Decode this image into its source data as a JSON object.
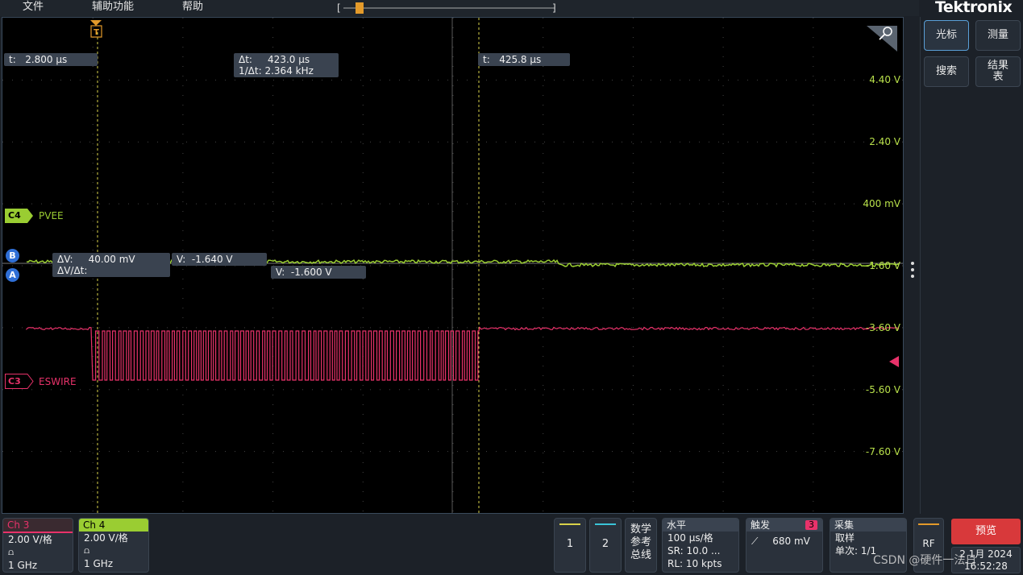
{
  "menu": {
    "file": "文件",
    "assist": "辅助功能",
    "help": "帮助"
  },
  "brand": "Tektronix",
  "colors": {
    "ch4": "#9acd32",
    "ch3": "#e8326a",
    "cursor": "#d9d24a",
    "cursor_white": "#b8b8b8",
    "accent_blue": "#2f6fd6",
    "preview": "#d8393b"
  },
  "cursors": {
    "t1": {
      "label": "t:",
      "value": "2.800 μs"
    },
    "t2": {
      "label": "t:",
      "value": "425.8 μs"
    },
    "delta_t": {
      "label": "Δt:",
      "value": "423.0 μs"
    },
    "inv_delta_t": {
      "label": "1/Δt:",
      "value": "2.364 kHz"
    },
    "delta_v": {
      "label": "ΔV:",
      "value": "40.00 mV"
    },
    "dv_dt": {
      "label": "ΔV/Δt:",
      "value": ""
    },
    "v_a": {
      "label": "V:",
      "value": "-1.640 V"
    },
    "v_b": {
      "label": "V:",
      "value": "-1.600 V"
    },
    "marker_a": "A",
    "marker_b": "B",
    "trigger_marker": "T"
  },
  "channels": {
    "c4": {
      "tag": "C4",
      "name": "PVEE"
    },
    "c3": {
      "tag": "C3",
      "name": "ESWIRE"
    }
  },
  "voltage_scale": [
    "4.40 V",
    "2.40 V",
    "400 mV",
    "-1.60 V",
    "-3.60 V",
    "-5.60 V",
    "-7.60 V"
  ],
  "right_panel": {
    "cursor": "光标",
    "measure": "测量",
    "search": "搜索",
    "results_1": "结果",
    "results_2": "表"
  },
  "bottom": {
    "ch3": {
      "title": "Ch 3",
      "scale": "2.00 V/格",
      "bw": "1 GHz"
    },
    "ch4": {
      "title": "Ch 4",
      "scale": "2.00 V/格",
      "bw": "1 GHz"
    },
    "ref1": "1",
    "ref2": "2",
    "digital": [
      "数学",
      "参考",
      "总线"
    ],
    "horizontal": {
      "title": "水平",
      "scale": "100 μs/格",
      "sr": "SR: 10.0 ...",
      "rl": "RL: 10 kpts"
    },
    "trigger": {
      "title": "触发",
      "source": "3",
      "level": "680 mV"
    },
    "acquire": {
      "title": "采集",
      "mode": "取样",
      "count": "单次: 1/1"
    },
    "rf": "RF",
    "preview": "预览",
    "date": "2 1月 2024",
    "time": "16:52:28"
  },
  "watermark": "CSDN @硬件一法日"
}
